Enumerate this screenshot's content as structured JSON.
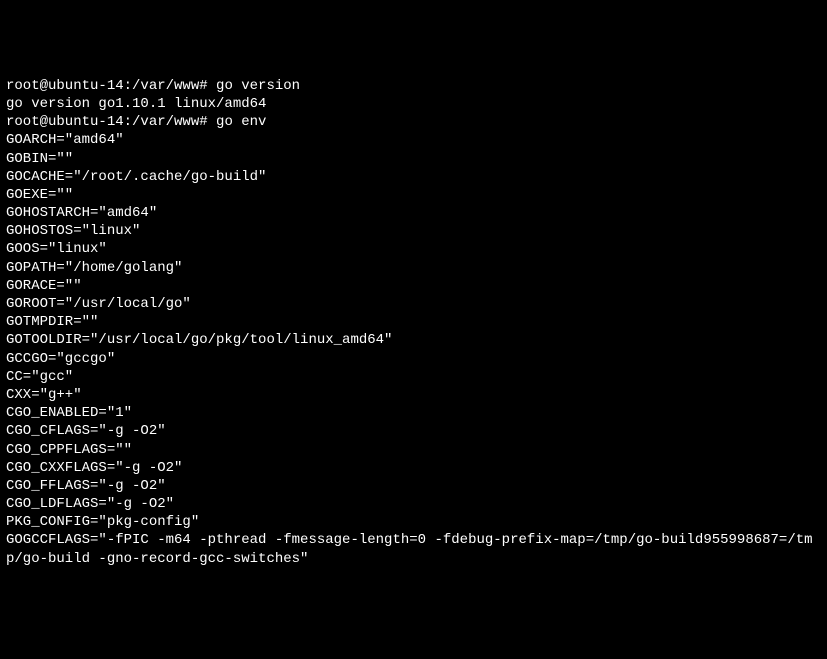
{
  "terminal": {
    "prompt1": "root@ubuntu-14:/var/www# ",
    "cmd1": "go version",
    "output1": "go version go1.10.1 linux/amd64",
    "prompt2": "root@ubuntu-14:/var/www# ",
    "cmd2": "go env",
    "env_lines": [
      "GOARCH=\"amd64\"",
      "GOBIN=\"\"",
      "GOCACHE=\"/root/.cache/go-build\"",
      "GOEXE=\"\"",
      "GOHOSTARCH=\"amd64\"",
      "GOHOSTOS=\"linux\"",
      "GOOS=\"linux\"",
      "GOPATH=\"/home/golang\"",
      "GORACE=\"\"",
      "GOROOT=\"/usr/local/go\"",
      "GOTMPDIR=\"\"",
      "GOTOOLDIR=\"/usr/local/go/pkg/tool/linux_amd64\"",
      "GCCGO=\"gccgo\"",
      "CC=\"gcc\"",
      "CXX=\"g++\"",
      "CGO_ENABLED=\"1\"",
      "CGO_CFLAGS=\"-g -O2\"",
      "CGO_CPPFLAGS=\"\"",
      "CGO_CXXFLAGS=\"-g -O2\"",
      "CGO_FFLAGS=\"-g -O2\"",
      "CGO_LDFLAGS=\"-g -O2\"",
      "PKG_CONFIG=\"pkg-config\"",
      "GOGCCFLAGS=\"-fPIC -m64 -pthread -fmessage-length=0 -fdebug-prefix-map=/tmp/go-build955998687=/tmp/go-build -gno-record-gcc-switches\""
    ]
  }
}
